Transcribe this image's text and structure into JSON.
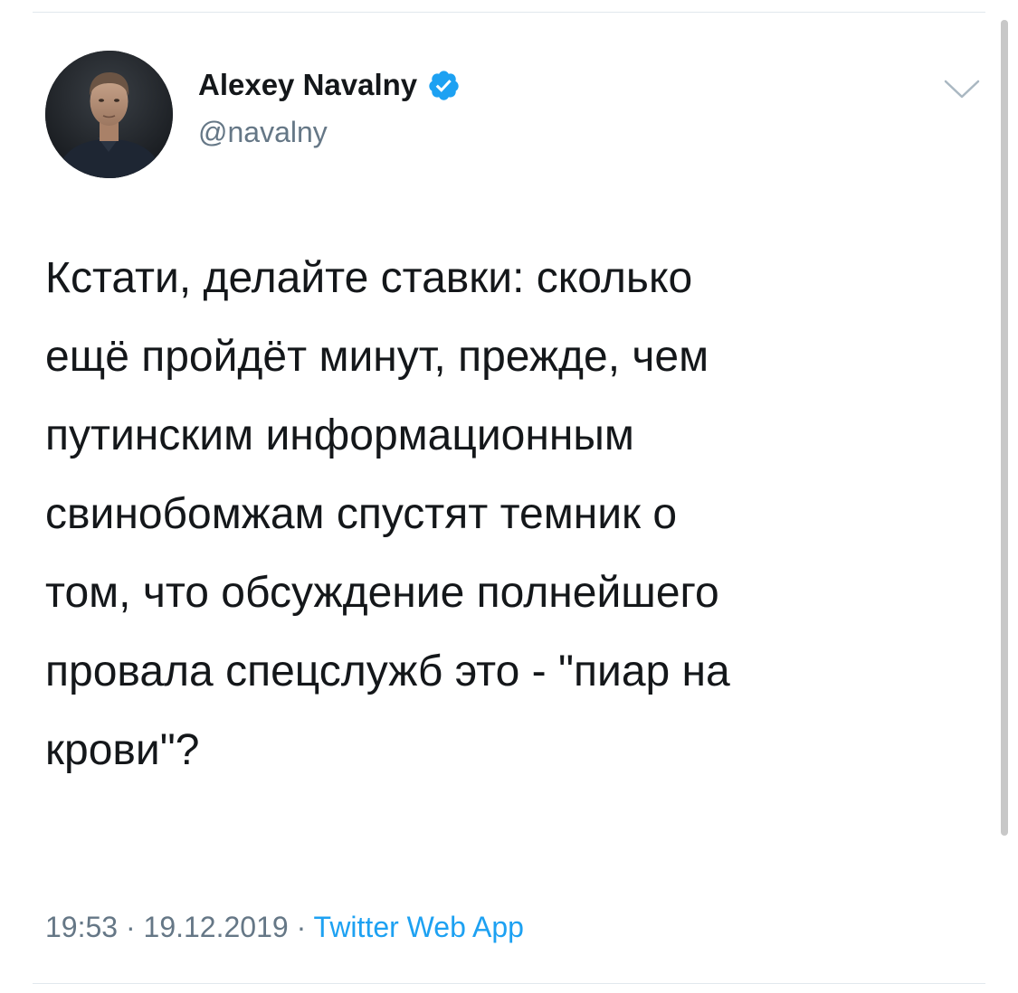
{
  "author": {
    "display_name": "Alexey Navalny",
    "handle": "@navalny",
    "verified": true,
    "avatar_icon": "profile-photo",
    "verified_icon": "verified-badge-icon",
    "menu_icon": "chevron-down-icon"
  },
  "tweet": {
    "text": "Кстати, делайте ставки: сколько\nещё пройдёт минут, прежде, чем\nпутинским информационным\nсвинобомжам спустят темник о\nтом, что обсуждение полнейшего\nпровала спецслужб это - \"пиар на\nкрови\"?",
    "time": "19:53",
    "separator": " · ",
    "date": "19.12.2019",
    "source": "Twitter Web App"
  },
  "colors": {
    "text_primary": "#14171a",
    "text_secondary": "#657786",
    "accent": "#1da1f2",
    "divider": "#e1e8ed"
  }
}
